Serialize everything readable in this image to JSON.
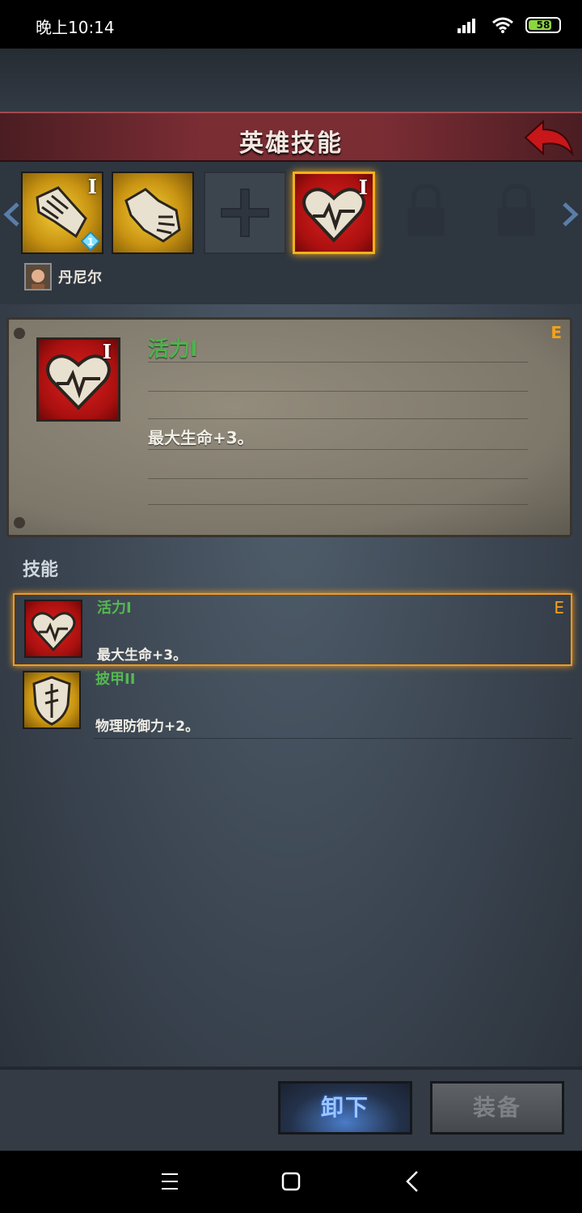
{
  "status": {
    "time": "晚上10:14",
    "battery": "58"
  },
  "header": {
    "title": "英雄技能"
  },
  "slots": [
    {
      "type": "gold",
      "roman": "I",
      "gem": "1"
    },
    {
      "type": "gold",
      "roman": ""
    },
    {
      "type": "empty"
    },
    {
      "type": "selected-heart",
      "roman": "I"
    },
    {
      "type": "locked"
    },
    {
      "type": "locked"
    }
  ],
  "hero": {
    "name": "丹尼尔"
  },
  "detail": {
    "name": "活力I",
    "grade": "E",
    "description": "最大生命+3。"
  },
  "skills_section": {
    "label": "技能"
  },
  "skills": [
    {
      "name": "活力I",
      "description": "最大生命+3。",
      "grade": "E",
      "icon": "heart-icon",
      "selected": true
    },
    {
      "name": "披甲II",
      "description": "物理防御力+2。",
      "grade": "",
      "icon": "shield-icon",
      "selected": false
    }
  ],
  "buttons": {
    "unequip": "卸下",
    "equip": "装备"
  },
  "colors": {
    "accent_orange": "#f29a1c",
    "skill_green": "#55b850",
    "title_red": "#7b2d34"
  },
  "icons": [
    "signal-icon",
    "wifi-icon",
    "battery-icon",
    "back-arrow-icon",
    "gauntlet-icon",
    "fist-icon",
    "cross-icon",
    "heart-icon",
    "lock-icon",
    "shield-icon",
    "menu-icon",
    "home-icon",
    "nav-back-icon"
  ]
}
